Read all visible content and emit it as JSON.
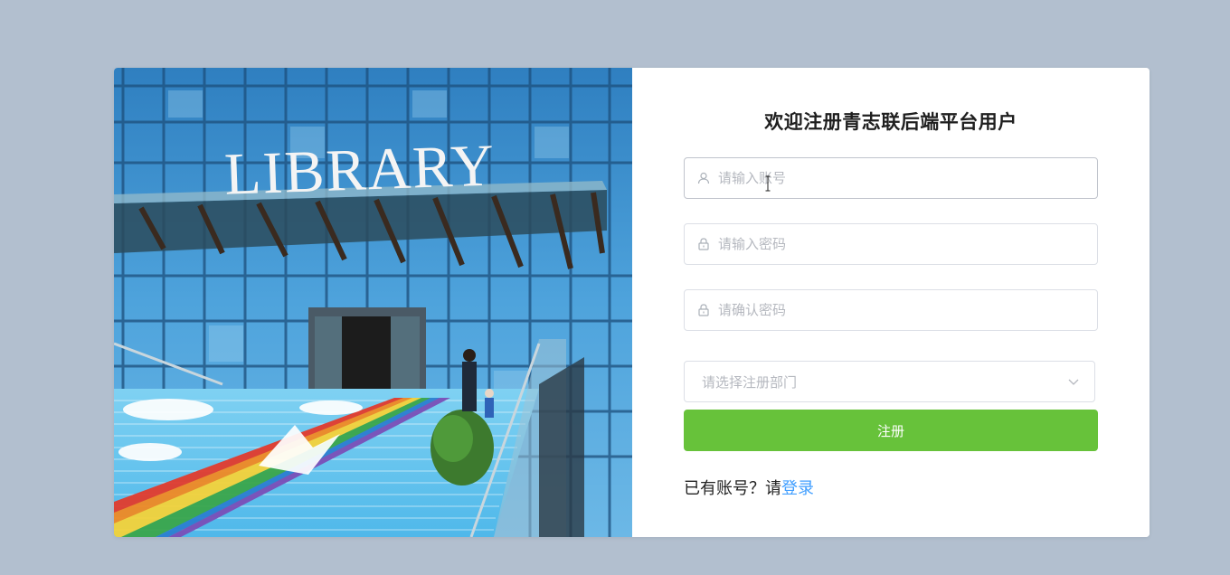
{
  "hero": {
    "sign_text": "LIBRARY"
  },
  "form": {
    "title": "欢迎注册青志联后端平台用户",
    "username_placeholder": "请输入账号",
    "password_placeholder": "请输入密码",
    "confirm_placeholder": "请确认密码",
    "department_placeholder": "请选择注册部门",
    "submit_label": "注册",
    "login_prompt": "已有账号？请",
    "login_link": "登录"
  },
  "icons": {
    "username": "user-icon",
    "password": "lock-icon",
    "confirm": "lock-icon",
    "department": "chevron-down-icon"
  },
  "colors": {
    "background": "#b2bfcf",
    "primary_button": "#67c23a",
    "link": "#409eff"
  }
}
